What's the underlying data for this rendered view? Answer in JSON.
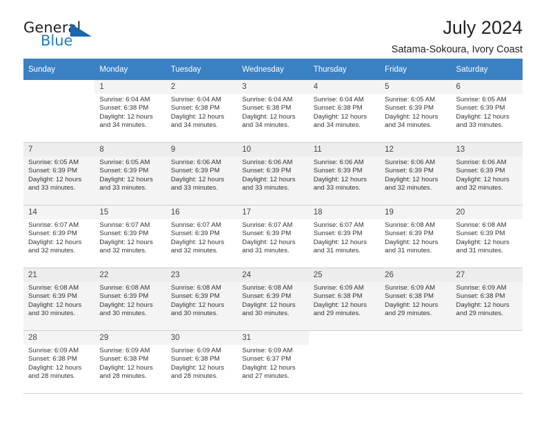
{
  "brand": {
    "name_top": "General",
    "name_bottom": "Blue",
    "accent_color": "#1668b0",
    "text_color": "#231f20"
  },
  "header": {
    "title": "July 2024",
    "subtitle": "Satama-Sokoura, Ivory Coast"
  },
  "calendar": {
    "header_bg": "#3a81c3",
    "header_text_color": "#ffffff",
    "weekdays": [
      "Sunday",
      "Monday",
      "Tuesday",
      "Wednesday",
      "Thursday",
      "Friday",
      "Saturday"
    ],
    "weeks": [
      {
        "shaded": false,
        "days": [
          {
            "num": "",
            "empty": true,
            "sunrise": "",
            "sunset": "",
            "daylight1": "",
            "daylight2": ""
          },
          {
            "num": "1",
            "empty": false,
            "sunrise": "Sunrise: 6:04 AM",
            "sunset": "Sunset: 6:38 PM",
            "daylight1": "Daylight: 12 hours",
            "daylight2": "and 34 minutes."
          },
          {
            "num": "2",
            "empty": false,
            "sunrise": "Sunrise: 6:04 AM",
            "sunset": "Sunset: 6:38 PM",
            "daylight1": "Daylight: 12 hours",
            "daylight2": "and 34 minutes."
          },
          {
            "num": "3",
            "empty": false,
            "sunrise": "Sunrise: 6:04 AM",
            "sunset": "Sunset: 6:38 PM",
            "daylight1": "Daylight: 12 hours",
            "daylight2": "and 34 minutes."
          },
          {
            "num": "4",
            "empty": false,
            "sunrise": "Sunrise: 6:04 AM",
            "sunset": "Sunset: 6:38 PM",
            "daylight1": "Daylight: 12 hours",
            "daylight2": "and 34 minutes."
          },
          {
            "num": "5",
            "empty": false,
            "sunrise": "Sunrise: 6:05 AM",
            "sunset": "Sunset: 6:39 PM",
            "daylight1": "Daylight: 12 hours",
            "daylight2": "and 34 minutes."
          },
          {
            "num": "6",
            "empty": false,
            "sunrise": "Sunrise: 6:05 AM",
            "sunset": "Sunset: 6:39 PM",
            "daylight1": "Daylight: 12 hours",
            "daylight2": "and 33 minutes."
          }
        ]
      },
      {
        "shaded": true,
        "days": [
          {
            "num": "7",
            "empty": false,
            "sunrise": "Sunrise: 6:05 AM",
            "sunset": "Sunset: 6:39 PM",
            "daylight1": "Daylight: 12 hours",
            "daylight2": "and 33 minutes."
          },
          {
            "num": "8",
            "empty": false,
            "sunrise": "Sunrise: 6:05 AM",
            "sunset": "Sunset: 6:39 PM",
            "daylight1": "Daylight: 12 hours",
            "daylight2": "and 33 minutes."
          },
          {
            "num": "9",
            "empty": false,
            "sunrise": "Sunrise: 6:06 AM",
            "sunset": "Sunset: 6:39 PM",
            "daylight1": "Daylight: 12 hours",
            "daylight2": "and 33 minutes."
          },
          {
            "num": "10",
            "empty": false,
            "sunrise": "Sunrise: 6:06 AM",
            "sunset": "Sunset: 6:39 PM",
            "daylight1": "Daylight: 12 hours",
            "daylight2": "and 33 minutes."
          },
          {
            "num": "11",
            "empty": false,
            "sunrise": "Sunrise: 6:06 AM",
            "sunset": "Sunset: 6:39 PM",
            "daylight1": "Daylight: 12 hours",
            "daylight2": "and 33 minutes."
          },
          {
            "num": "12",
            "empty": false,
            "sunrise": "Sunrise: 6:06 AM",
            "sunset": "Sunset: 6:39 PM",
            "daylight1": "Daylight: 12 hours",
            "daylight2": "and 32 minutes."
          },
          {
            "num": "13",
            "empty": false,
            "sunrise": "Sunrise: 6:06 AM",
            "sunset": "Sunset: 6:39 PM",
            "daylight1": "Daylight: 12 hours",
            "daylight2": "and 32 minutes."
          }
        ]
      },
      {
        "shaded": false,
        "days": [
          {
            "num": "14",
            "empty": false,
            "sunrise": "Sunrise: 6:07 AM",
            "sunset": "Sunset: 6:39 PM",
            "daylight1": "Daylight: 12 hours",
            "daylight2": "and 32 minutes."
          },
          {
            "num": "15",
            "empty": false,
            "sunrise": "Sunrise: 6:07 AM",
            "sunset": "Sunset: 6:39 PM",
            "daylight1": "Daylight: 12 hours",
            "daylight2": "and 32 minutes."
          },
          {
            "num": "16",
            "empty": false,
            "sunrise": "Sunrise: 6:07 AM",
            "sunset": "Sunset: 6:39 PM",
            "daylight1": "Daylight: 12 hours",
            "daylight2": "and 32 minutes."
          },
          {
            "num": "17",
            "empty": false,
            "sunrise": "Sunrise: 6:07 AM",
            "sunset": "Sunset: 6:39 PM",
            "daylight1": "Daylight: 12 hours",
            "daylight2": "and 31 minutes."
          },
          {
            "num": "18",
            "empty": false,
            "sunrise": "Sunrise: 6:07 AM",
            "sunset": "Sunset: 6:39 PM",
            "daylight1": "Daylight: 12 hours",
            "daylight2": "and 31 minutes."
          },
          {
            "num": "19",
            "empty": false,
            "sunrise": "Sunrise: 6:08 AM",
            "sunset": "Sunset: 6:39 PM",
            "daylight1": "Daylight: 12 hours",
            "daylight2": "and 31 minutes."
          },
          {
            "num": "20",
            "empty": false,
            "sunrise": "Sunrise: 6:08 AM",
            "sunset": "Sunset: 6:39 PM",
            "daylight1": "Daylight: 12 hours",
            "daylight2": "and 31 minutes."
          }
        ]
      },
      {
        "shaded": true,
        "days": [
          {
            "num": "21",
            "empty": false,
            "sunrise": "Sunrise: 6:08 AM",
            "sunset": "Sunset: 6:39 PM",
            "daylight1": "Daylight: 12 hours",
            "daylight2": "and 30 minutes."
          },
          {
            "num": "22",
            "empty": false,
            "sunrise": "Sunrise: 6:08 AM",
            "sunset": "Sunset: 6:39 PM",
            "daylight1": "Daylight: 12 hours",
            "daylight2": "and 30 minutes."
          },
          {
            "num": "23",
            "empty": false,
            "sunrise": "Sunrise: 6:08 AM",
            "sunset": "Sunset: 6:39 PM",
            "daylight1": "Daylight: 12 hours",
            "daylight2": "and 30 minutes."
          },
          {
            "num": "24",
            "empty": false,
            "sunrise": "Sunrise: 6:08 AM",
            "sunset": "Sunset: 6:39 PM",
            "daylight1": "Daylight: 12 hours",
            "daylight2": "and 30 minutes."
          },
          {
            "num": "25",
            "empty": false,
            "sunrise": "Sunrise: 6:09 AM",
            "sunset": "Sunset: 6:38 PM",
            "daylight1": "Daylight: 12 hours",
            "daylight2": "and 29 minutes."
          },
          {
            "num": "26",
            "empty": false,
            "sunrise": "Sunrise: 6:09 AM",
            "sunset": "Sunset: 6:38 PM",
            "daylight1": "Daylight: 12 hours",
            "daylight2": "and 29 minutes."
          },
          {
            "num": "27",
            "empty": false,
            "sunrise": "Sunrise: 6:09 AM",
            "sunset": "Sunset: 6:38 PM",
            "daylight1": "Daylight: 12 hours",
            "daylight2": "and 29 minutes."
          }
        ]
      },
      {
        "shaded": false,
        "days": [
          {
            "num": "28",
            "empty": false,
            "sunrise": "Sunrise: 6:09 AM",
            "sunset": "Sunset: 6:38 PM",
            "daylight1": "Daylight: 12 hours",
            "daylight2": "and 28 minutes."
          },
          {
            "num": "29",
            "empty": false,
            "sunrise": "Sunrise: 6:09 AM",
            "sunset": "Sunset: 6:38 PM",
            "daylight1": "Daylight: 12 hours",
            "daylight2": "and 28 minutes."
          },
          {
            "num": "30",
            "empty": false,
            "sunrise": "Sunrise: 6:09 AM",
            "sunset": "Sunset: 6:38 PM",
            "daylight1": "Daylight: 12 hours",
            "daylight2": "and 28 minutes."
          },
          {
            "num": "31",
            "empty": false,
            "sunrise": "Sunrise: 6:09 AM",
            "sunset": "Sunset: 6:37 PM",
            "daylight1": "Daylight: 12 hours",
            "daylight2": "and 27 minutes."
          },
          {
            "num": "",
            "empty": true,
            "sunrise": "",
            "sunset": "",
            "daylight1": "",
            "daylight2": ""
          },
          {
            "num": "",
            "empty": true,
            "sunrise": "",
            "sunset": "",
            "daylight1": "",
            "daylight2": ""
          },
          {
            "num": "",
            "empty": true,
            "sunrise": "",
            "sunset": "",
            "daylight1": "",
            "daylight2": ""
          }
        ]
      }
    ]
  }
}
